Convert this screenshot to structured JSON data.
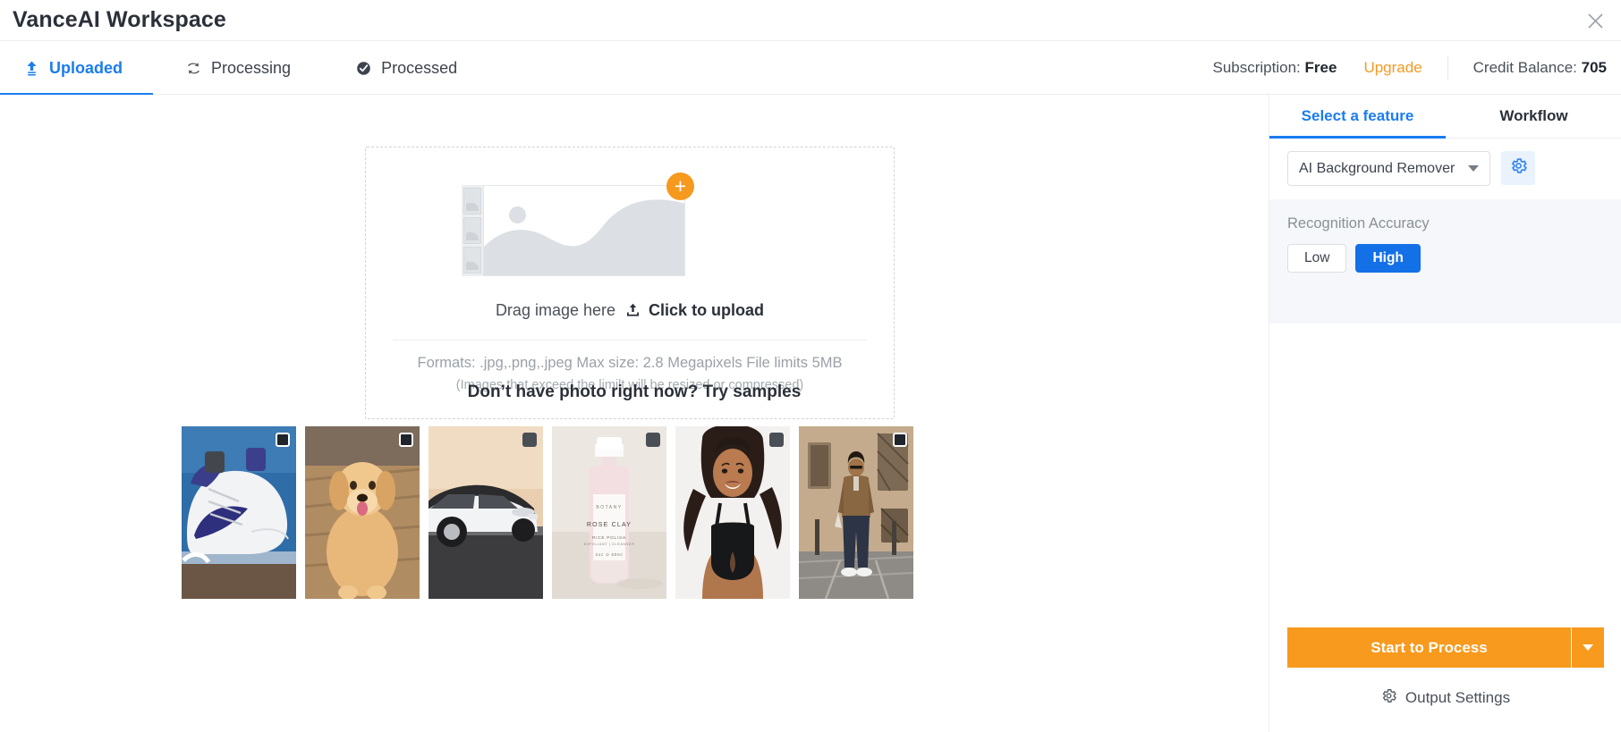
{
  "window": {
    "title": "VanceAI Workspace",
    "close_icon": "close-icon"
  },
  "tabs": [
    {
      "label": "Uploaded",
      "icon": "upload-arrow-icon",
      "active": true
    },
    {
      "label": "Processing",
      "icon": "refresh-sync-icon",
      "active": false
    },
    {
      "label": "Processed",
      "icon": "check-circle-icon",
      "active": false
    }
  ],
  "account": {
    "subscription_label": "Subscription:",
    "subscription_value": "Free",
    "upgrade_label": "Upgrade",
    "credit_label": "Credit Balance:",
    "credit_value": "705"
  },
  "dropzone": {
    "drag_text": "Drag image here",
    "upload_icon": "upload-tray-icon",
    "click_text": "Click to upload",
    "plus_icon": "plus-icon",
    "add_symbol": "+",
    "formats": "Formats: .jpg,.png,.jpeg Max size: 2.8 Megapixels File limits 5MB",
    "note": "(Images that exceed the limilt will be resized or compressed)"
  },
  "samples": {
    "title": "Don’t have photo right now? Try samples",
    "items": [
      {
        "name": "white-sneakers-on-blue-court",
        "checkbox": "sample-checkbox"
      },
      {
        "name": "golden-retriever-puppy",
        "checkbox": "sample-checkbox"
      },
      {
        "name": "white-car-at-sunset",
        "checkbox": "sample-checkbox"
      },
      {
        "name": "rose-clay-cosmetic-bottle",
        "checkbox": "sample-checkbox"
      },
      {
        "name": "woman-in-black-sports-bra",
        "checkbox": "sample-checkbox"
      },
      {
        "name": "man-standing-on-street",
        "checkbox": "sample-checkbox"
      }
    ]
  },
  "panel": {
    "tabs": [
      {
        "label": "Select a feature",
        "active": true
      },
      {
        "label": "Workflow",
        "active": false
      }
    ],
    "feature_select": {
      "value": "AI Background Remover",
      "caret_icon": "chevron-down-icon",
      "settings_icon": "gear-icon"
    },
    "accuracy": {
      "label": "Recognition Accuracy",
      "options": [
        {
          "label": "Low",
          "selected": false
        },
        {
          "label": "High",
          "selected": true
        }
      ]
    },
    "start": {
      "label": "Start to Process",
      "caret_icon": "chevron-down-icon"
    },
    "output": {
      "icon": "gear-icon",
      "label": "Output Settings"
    }
  },
  "colors": {
    "accent_blue": "#1a7cf0",
    "accent_orange": "#f79a1e",
    "upgrade_orange": "#f59a23",
    "panel_gray": "#f5f7fa",
    "text_dark": "#2b3039"
  }
}
